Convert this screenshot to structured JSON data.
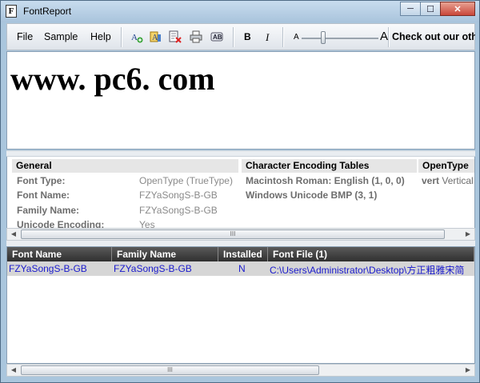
{
  "window": {
    "title": "FontReport",
    "minimize": "─",
    "maximize": "☐",
    "close": "✕"
  },
  "menu": {
    "file": "File",
    "sample": "Sample",
    "help": "Help"
  },
  "toolbar": {
    "bold": "B",
    "italic": "I",
    "size_small": "A",
    "size_large": "A",
    "size_value": 0.28,
    "sample_text": "Check out our other",
    "icons": [
      "add-font-icon",
      "font-properties-icon",
      "remove-font-icon",
      "print-icon",
      "compare-icon"
    ]
  },
  "preview": {
    "text": "www. pc6. com"
  },
  "info": {
    "general": {
      "header": "General",
      "rows": [
        {
          "label": "Font Type:",
          "value": "OpenType (TrueType)"
        },
        {
          "label": "Font Name:",
          "value": "FZYaSongS-B-GB"
        },
        {
          "label": "Family Name:",
          "value": "FZYaSongS-B-GB"
        },
        {
          "label": "Unicode Encoding:",
          "value": "Yes"
        }
      ]
    },
    "encoding": {
      "header": "Character Encoding Tables",
      "rows": [
        "Macintosh Roman: English (1, 0, 0)",
        "Windows Unicode BMP (3, 1)"
      ]
    },
    "opentype": {
      "header": "OpenType",
      "feature_tag": "vert",
      "feature_name": "Vertical"
    },
    "scroll": {
      "thumb_label": "III"
    }
  },
  "list": {
    "columns": [
      "Font Name",
      "Family Name",
      "Installed",
      "Font File (1)"
    ],
    "rows": [
      {
        "font_name": "FZYaSongS-B-GB",
        "family_name": "FZYaSongS-B-GB",
        "installed": "N",
        "font_file": "C:\\Users\\Administrator\\Desktop\\方正粗雅宋简"
      }
    ],
    "scroll": {
      "thumb_label": "III"
    }
  }
}
